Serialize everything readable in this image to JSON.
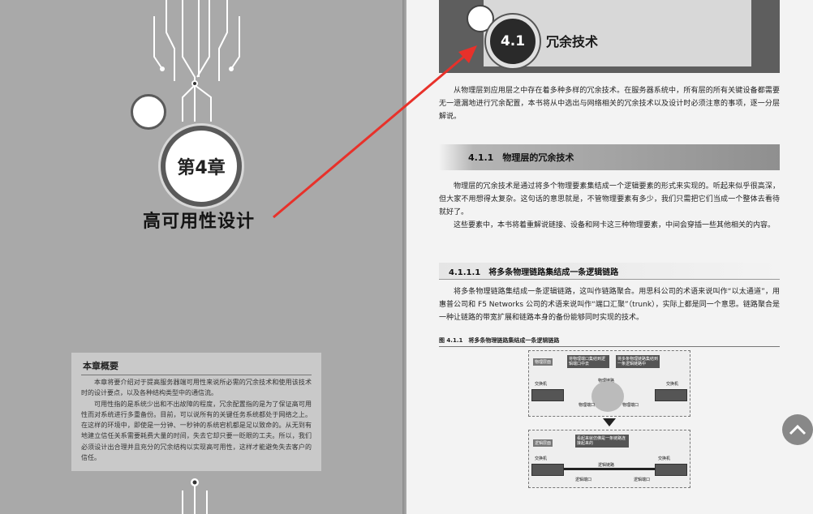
{
  "left_page": {
    "chapter_badge": "第4章",
    "chapter_title": "高可用性设计",
    "summary": {
      "heading": "本章概要",
      "paragraphs": [
        "本章将要介绍对于提高服务器端可用性来说所必需的冗余技术和使用该技术时的设计要点，以及各种结构类型中的通信流。",
        "可用性指的是系统少出和不出故障的程度，冗余配置指的是为了保证高可用性而对系统进行多重备份。目前，可以说所有的关键任务系统都处于网络之上。在这样的环境中，即使是一分钟、一秒钟的系统宕机都是足以致命的。从无到有地建立信任关系需要耗费大量的时间，失去它却只要一眨眼的工夫。所以，我们必须设计出合理并且充分的冗余结构以实现高可用性，这样才能避免失去客户的信任。"
      ]
    }
  },
  "right_page": {
    "section_number": "4.1",
    "section_title": "冗余技术",
    "intro": "从物理层到应用层之中存在着多种多样的冗余技术。在服务器系统中，所有层的所有关键设备都需要无一遗漏地进行冗余配置，本书将从中选出与网络相关的冗余技术以及设计时必须注意的事项，逐一分层解说。",
    "subsection": "4.1.1　物理层的冗余技术",
    "sub_paragraphs": [
      "物理层的冗余技术是通过将多个物理要素集结成一个逻辑要素的形式来实现的。听起来似乎很高深，但大家不用想得太复杂。这句话的意思就是，不管物理要素有多少，我们只需把它们当成一个整体去看待就好了。",
      "这些要素中，本书将着重解说链接、设备和网卡这三种物理要素，中间会穿插一些其他相关的内容。"
    ],
    "subsubsection": "4.1.1.1　将多条物理链路集结成一条逻辑链路",
    "link_paragraph": "将多条物理链路集结成一条逻辑链路，这叫作链路聚合。用思科公司的术语来说叫作“以太通道”，用惠普公司和 F5 Networks 公司的术语来说叫作“端口汇聚”（trunk），实际上都是同一个意思。链路聚合是一种让链路的带宽扩展和链路本身的备份能够同时实现的技术。",
    "figure_caption": "图 4.1.1　将多条物理链路集结成一条逻辑链路",
    "diagram": {
      "top_tag": "物理层面",
      "top_note1": "将物理端口集结到逻辑端口中去",
      "top_note2": "将多条物理链路集结到一条逻辑链路中",
      "switch_label": "交换机",
      "phys_link": "物理链路",
      "phys_port": "物理端口",
      "bottom_tag": "逻辑层面",
      "bottom_note": "看起来就仿佛是一条链路连接起来的",
      "logical_link": "逻辑链路",
      "logical_port": "逻辑端口"
    }
  },
  "scroll_top_icon": "chevron-up-icon"
}
